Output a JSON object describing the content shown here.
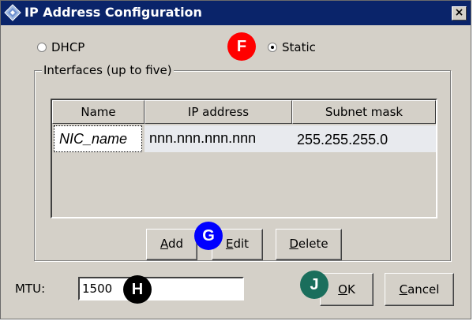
{
  "window": {
    "title": "IP Address Configuration",
    "close_label": "×"
  },
  "mode": {
    "dhcp_label": "DHCP",
    "static_label": "Static",
    "selected": "Static"
  },
  "interfaces": {
    "group_label": "Interfaces (up to five)",
    "columns": [
      "Name",
      "IP address",
      "Subnet mask"
    ],
    "rows": [
      {
        "name": "NIC_name",
        "ip": "nnn.nnn.nnn.nnn",
        "mask": "255.255.255.0"
      }
    ]
  },
  "buttons": {
    "add_mnemonic": "A",
    "add_rest": "dd",
    "edit_mnemonic": "E",
    "edit_rest": "dit",
    "delete_mnemonic": "D",
    "delete_rest": "elete",
    "ok_mnemonic": "O",
    "ok_rest": "K",
    "cancel_mnemonic": "C",
    "cancel_rest": "ancel"
  },
  "mtu": {
    "label": "MTU:",
    "value": "1500"
  },
  "badges": {
    "f": {
      "text": "F",
      "color": "#ff0000"
    },
    "g": {
      "text": "G",
      "color": "#0000ff"
    },
    "h": {
      "text": "H",
      "color": "#000000"
    },
    "j": {
      "text": "J",
      "color": "#1a6e5c"
    }
  },
  "colors": {
    "titlebar": "#0a246a",
    "dialog_bg": "#d4d0c8",
    "row_selected_bg": "#e8eaee"
  }
}
